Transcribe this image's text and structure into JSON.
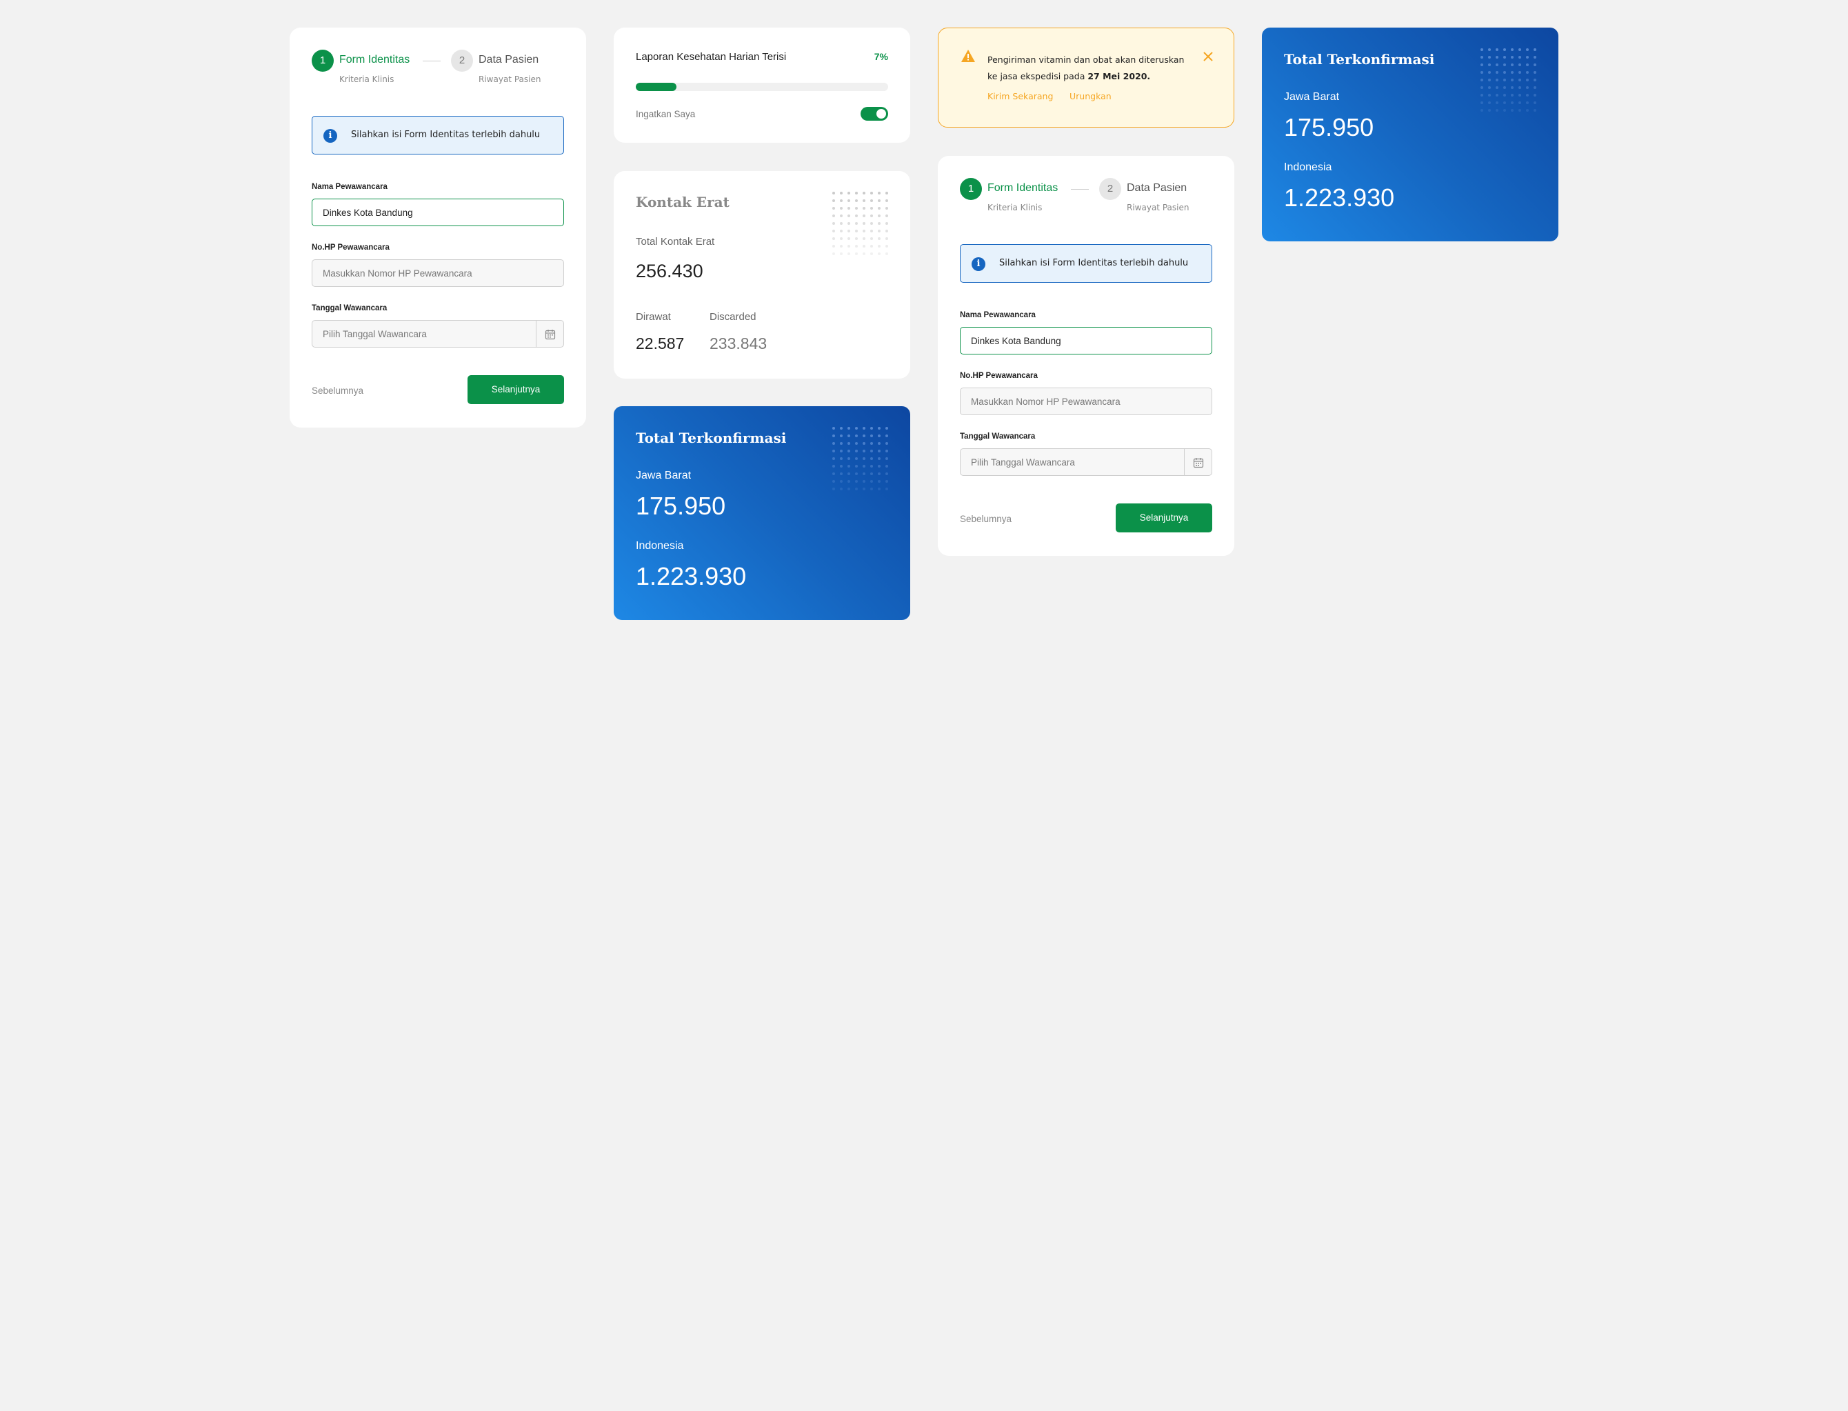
{
  "form_card": {
    "steps": [
      {
        "number": "1",
        "title": "Form Identitas",
        "subtitle": "Kriteria Klinis"
      },
      {
        "number": "2",
        "title": "Data Pasien",
        "subtitle": "Riwayat Pasien"
      }
    ],
    "info_message": "Silahkan isi Form Identitas terlebih dahulu",
    "fields": {
      "interviewer_name": {
        "label": "Nama Pewawancara",
        "value": "Dinkes Kota Bandung"
      },
      "interviewer_phone": {
        "label": "No.HP Pewawancara",
        "placeholder": "Masukkan Nomor HP Pewawancara"
      },
      "interview_date": {
        "label": "Tanggal Wawancara",
        "placeholder": "Pilih Tanggal Wawancara"
      }
    },
    "prev_label": "Sebelumnya",
    "next_label": "Selanjutnya"
  },
  "progress_card": {
    "title": "Laporan Kesehatan Harian Terisi",
    "percent_label": "7%",
    "progress_fraction": 0.07,
    "remember_label": "Ingatkan Saya",
    "remember_on": true
  },
  "kontak_card": {
    "title": "Kontak Erat",
    "total_label": "Total Kontak Erat",
    "total_value": "256.430",
    "dirawat_label": "Dirawat",
    "dirawat_value": "22.587",
    "discarded_label": "Discarded",
    "discarded_value": "233.843"
  },
  "confirmed_card": {
    "title": "Total Terkonfirmasi",
    "region_label": "Jawa Barat",
    "region_value": "175.950",
    "country_label": "Indonesia",
    "country_value": "1.223.930"
  },
  "alert": {
    "message_prefix": "Pengiriman vitamin dan obat akan diteruskan ke jasa ekspedisi pada ",
    "message_date": "27 Mei 2020.",
    "action_primary": "Kirim Sekarang",
    "action_secondary": "Urungkan"
  },
  "colors": {
    "primary_green": "#0b9149",
    "info_blue": "#1565c0",
    "warning_orange": "#f5a623",
    "card_blue_dark": "#0d47a1",
    "card_blue_light": "#1e88e5"
  },
  "icons": [
    "info-icon",
    "calendar-icon",
    "warning-icon",
    "close-icon",
    "toggle-switch"
  ]
}
